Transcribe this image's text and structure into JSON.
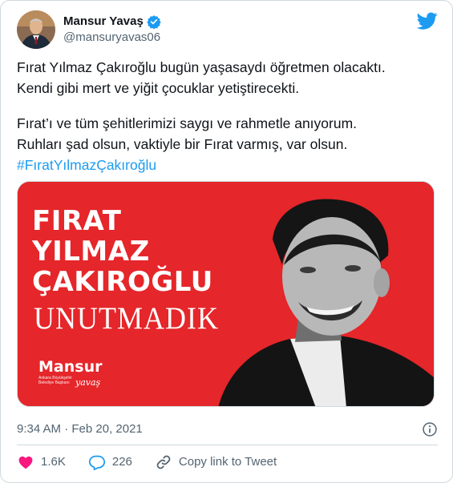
{
  "author": {
    "display_name": "Mansur Yavaş",
    "handle": "@mansuryavas06"
  },
  "tweet": {
    "line1": "Fırat Yılmaz Çakıroğlu bugün yaşasaydı öğretmen olacaktı.",
    "line2": "Kendi gibi mert ve yiğit çocuklar yetiştirecekti.",
    "line3": "Fırat’ı ve tüm şehitlerimizi saygı ve rahmetle anıyorum.",
    "line4": "Ruhları şad olsun, vaktiyle bir Fırat varmış, var olsun.",
    "hashtag": "#FıratYılmazÇakıroğlu"
  },
  "media": {
    "title_line1": "FIRAT",
    "title_line2": "YILMAZ",
    "title_line3": "ÇAKIROĞLU",
    "subtitle": "UNUTMADIK",
    "logo_name": "Mansur",
    "logo_sub": "Ankara Büyükşehir Belediye Başkanı",
    "logo_sign": "yavaş",
    "background_color": "#e5262a"
  },
  "meta": {
    "timestamp": "9:34 AM · Feb 20, 2021"
  },
  "actions": {
    "likes": "1.6K",
    "replies": "226",
    "copy_link": "Copy link to Tweet"
  },
  "colors": {
    "accent": "#1d9bf0",
    "like": "#f91880",
    "text": "#0f1419",
    "secondary": "#536471"
  }
}
